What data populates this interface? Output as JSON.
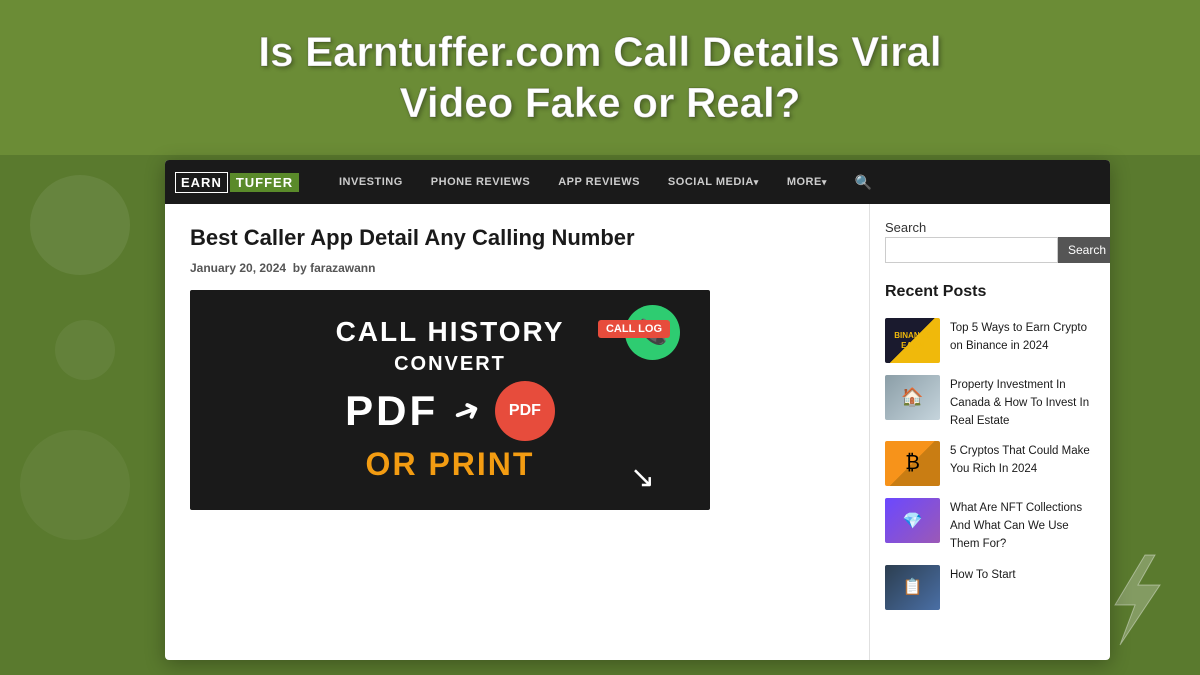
{
  "page": {
    "title_line1": "Is Earntuffer.com Call Details Viral",
    "title_line2": "Video Fake or Real?"
  },
  "navbar": {
    "logo_earn": "EARN",
    "logo_tuffer": "TUFFER",
    "nav_items": [
      {
        "label": "INVESTING",
        "has_arrow": false
      },
      {
        "label": "PHONE REVIEWS",
        "has_arrow": false
      },
      {
        "label": "APP REVIEWS",
        "has_arrow": false
      },
      {
        "label": "SOCIAL MEDIA",
        "has_arrow": true
      },
      {
        "label": "More",
        "has_arrow": true
      }
    ]
  },
  "article": {
    "title": "Best Caller App Detail Any Calling Number",
    "meta_date": "January 20, 2024",
    "meta_by": "by",
    "meta_author": "farazawann",
    "image": {
      "line1": "CALL HISTORY",
      "line2": "CONVERT",
      "line3": "PDF",
      "badge": "PDF",
      "call_log": "CALL LOG",
      "or_print": "OR PRINT"
    }
  },
  "sidebar": {
    "search_label": "Search",
    "search_placeholder": "",
    "search_button": "Search",
    "recent_posts_title": "Recent Posts",
    "posts": [
      {
        "thumb_type": "crypto",
        "thumb_label": "BINANCE EARN",
        "title": "Top 5 Ways to Earn Crypto on Binance in 2024"
      },
      {
        "thumb_type": "property",
        "thumb_label": "🏠",
        "title": "Property Investment In Canada & How To Invest In Real Estate"
      },
      {
        "thumb_type": "bitcoin",
        "thumb_label": "₿",
        "title": "5 Cryptos That Could Make You Rich In 2024"
      },
      {
        "thumb_type": "nft",
        "thumb_label": "💎",
        "title": "What Are NFT Collections And What Can We Use Them For?"
      },
      {
        "thumb_type": "howto",
        "thumb_label": "📋",
        "title": "How To Start"
      }
    ]
  }
}
